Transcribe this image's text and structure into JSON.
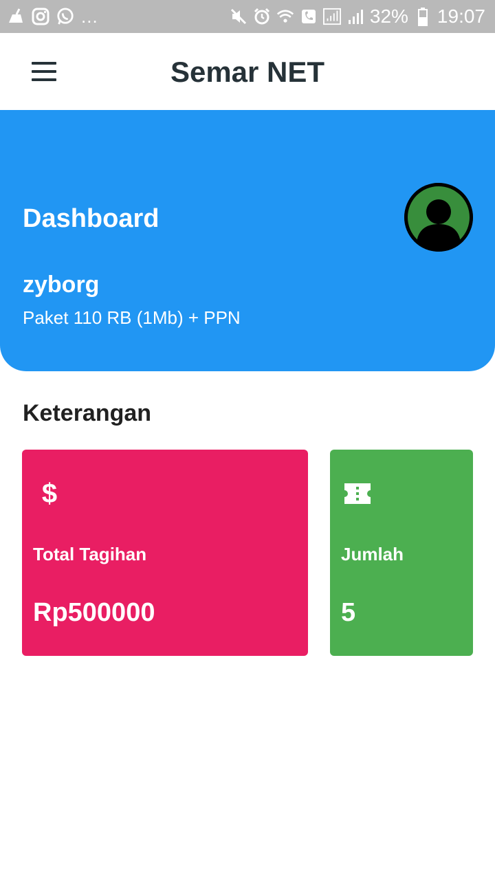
{
  "status_bar": {
    "more": "...",
    "battery": "32%",
    "time": "19:07",
    "left_icons": [
      "cleaner-icon",
      "instagram-icon",
      "whatsapp-icon"
    ],
    "right_icons": [
      "mute-icon",
      "alarm-icon",
      "wifi-icon",
      "call-icon",
      "signal-icon",
      "signal-icon",
      "battery-icon"
    ]
  },
  "app_bar": {
    "title": "Semar NET",
    "menu_icon": "menu-icon"
  },
  "hero": {
    "title": "Dashboard",
    "username": "zyborg",
    "plan": "Paket 110 RB (1Mb) + PPN",
    "background": "#2196f3",
    "avatar_icon": "user-avatar-icon"
  },
  "section": {
    "title": "Keterangan"
  },
  "cards": [
    {
      "icon": "dollar-icon",
      "icon_glyph": "$",
      "label": "Total Tagihan",
      "value": "Rp500000",
      "color": "#e91e63"
    },
    {
      "icon": "ticket-icon",
      "label": "Jumlah",
      "value": "5",
      "color": "#4caf50"
    }
  ]
}
